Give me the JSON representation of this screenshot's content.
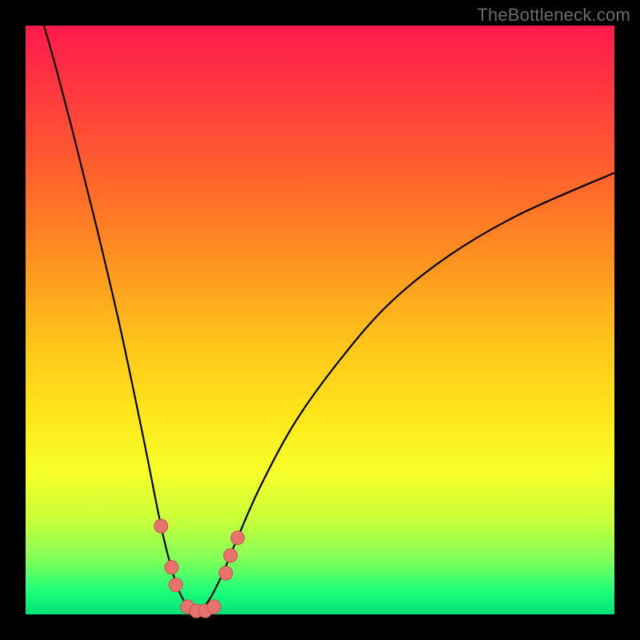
{
  "watermark": {
    "text": "TheBottleneck.com"
  },
  "colors": {
    "curve_stroke": "#000000",
    "marker_fill": "#e8736e",
    "marker_stroke": "#c9524d",
    "background": "#000000"
  },
  "chart_data": {
    "type": "line",
    "title": "",
    "xlabel": "",
    "ylabel": "",
    "xlim": [
      0,
      100
    ],
    "ylim": [
      0,
      100
    ],
    "grid": false,
    "legend": false,
    "x": [
      0,
      4,
      8,
      12,
      16,
      20,
      23,
      25,
      26.5,
      28,
      29,
      30,
      31.5,
      33.5,
      36,
      40,
      46,
      54,
      62,
      72,
      84,
      100
    ],
    "series": [
      {
        "name": "bottleneck-curve",
        "values": [
          110,
          97,
          82,
          66,
          49,
          30,
          15,
          7,
          3,
          1,
          0.5,
          1,
          3,
          7,
          13,
          22,
          33,
          44,
          53,
          61,
          68,
          75
        ]
      }
    ],
    "markers": [
      {
        "x": 23.0,
        "y": 15.0
      },
      {
        "x": 24.8,
        "y": 8.0
      },
      {
        "x": 25.5,
        "y": 5.0
      },
      {
        "x": 27.5,
        "y": 1.3
      },
      {
        "x": 29.0,
        "y": 0.6
      },
      {
        "x": 30.5,
        "y": 0.6
      },
      {
        "x": 32.0,
        "y": 1.3
      },
      {
        "x": 34.0,
        "y": 7.0
      },
      {
        "x": 34.8,
        "y": 10.0
      },
      {
        "x": 36.0,
        "y": 13.0
      }
    ]
  }
}
